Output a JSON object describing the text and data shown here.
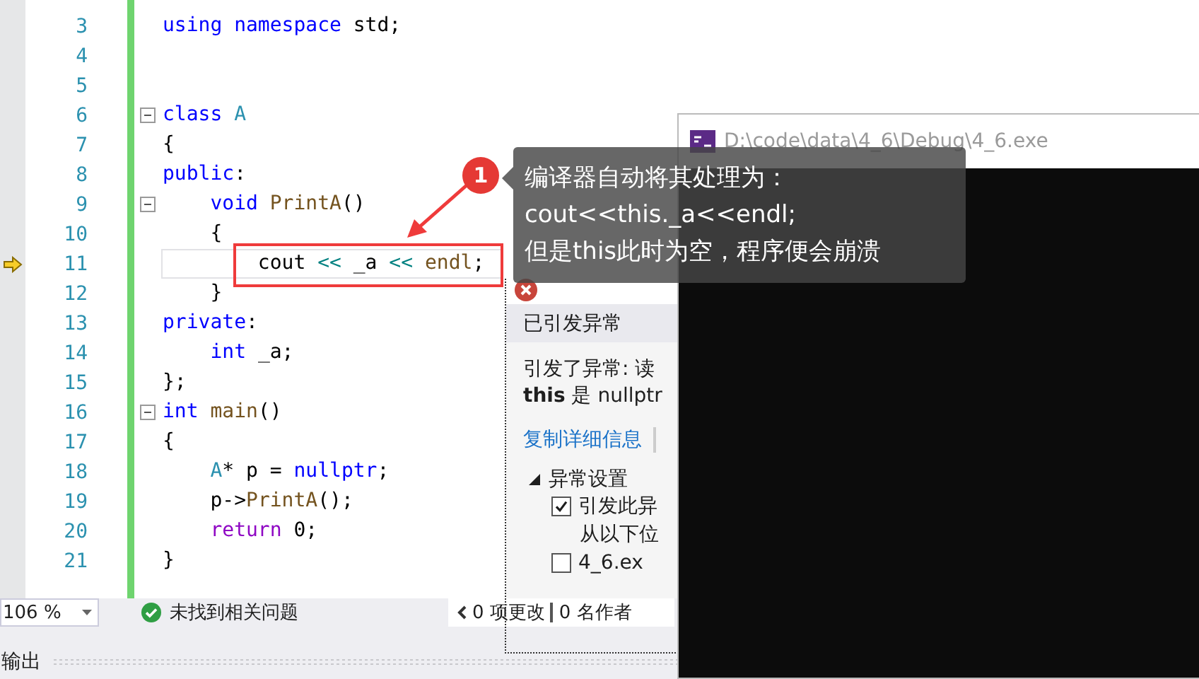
{
  "editor": {
    "lines": [
      {
        "number": "3",
        "fold": false,
        "current": false,
        "tokens": [
          {
            "kind": "keyword",
            "text": "using namespace"
          },
          {
            "kind": "plain",
            "text": " std;"
          }
        ]
      },
      {
        "number": "4",
        "fold": false,
        "current": false
      },
      {
        "number": "5",
        "fold": false,
        "current": false
      },
      {
        "number": "6",
        "fold": true,
        "current": false,
        "tokens": [
          {
            "kind": "keyword",
            "text": "class"
          },
          {
            "kind": "type",
            "text": " A"
          }
        ]
      },
      {
        "number": "7",
        "fold": false,
        "current": false,
        "tokens": [
          {
            "kind": "plain",
            "text": "{"
          }
        ]
      },
      {
        "number": "8",
        "fold": false,
        "current": false,
        "tokens": [
          {
            "kind": "keyword",
            "text": "public"
          },
          {
            "kind": "plain",
            "text": ":"
          }
        ]
      },
      {
        "number": "9",
        "fold": true,
        "current": false,
        "tokens": [
          {
            "kind": "keyword",
            "text": "    void"
          },
          {
            "kind": "function",
            "text": " PrintA"
          },
          {
            "kind": "plain",
            "text": "()"
          }
        ]
      },
      {
        "number": "10",
        "fold": false,
        "current": false,
        "tokens": [
          {
            "kind": "plain",
            "text": "    {"
          }
        ]
      },
      {
        "number": "11",
        "fold": false,
        "current": true,
        "tokens": [
          {
            "kind": "plain",
            "text": "        cout"
          },
          {
            "kind": "operator",
            "text": " <<"
          },
          {
            "kind": "plain",
            "text": " _a"
          },
          {
            "kind": "operator",
            "text": " <<"
          },
          {
            "kind": "function",
            "text": " endl"
          },
          {
            "kind": "plain",
            "text": ";"
          }
        ]
      },
      {
        "number": "12",
        "fold": false,
        "current": false,
        "tokens": [
          {
            "kind": "plain",
            "text": "    }"
          }
        ]
      },
      {
        "number": "13",
        "fold": false,
        "current": false,
        "tokens": [
          {
            "kind": "keyword",
            "text": "private"
          },
          {
            "kind": "plain",
            "text": ":"
          }
        ]
      },
      {
        "number": "14",
        "fold": false,
        "current": false,
        "tokens": [
          {
            "kind": "keyword",
            "text": "    int"
          },
          {
            "kind": "plain",
            "text": " _a;"
          }
        ]
      },
      {
        "number": "15",
        "fold": false,
        "current": false,
        "tokens": [
          {
            "kind": "plain",
            "text": "};"
          }
        ]
      },
      {
        "number": "16",
        "fold": true,
        "current": false,
        "tokens": [
          {
            "kind": "keyword",
            "text": "int"
          },
          {
            "kind": "function",
            "text": " main"
          },
          {
            "kind": "plain",
            "text": "()"
          }
        ]
      },
      {
        "number": "17",
        "fold": false,
        "current": false,
        "tokens": [
          {
            "kind": "plain",
            "text": "{"
          }
        ]
      },
      {
        "number": "18",
        "fold": false,
        "current": false,
        "tokens": [
          {
            "kind": "type",
            "text": "    A"
          },
          {
            "kind": "plain",
            "text": "* p = "
          },
          {
            "kind": "keyword",
            "text": "nullptr"
          },
          {
            "kind": "plain",
            "text": ";"
          }
        ]
      },
      {
        "number": "19",
        "fold": false,
        "current": false,
        "tokens": [
          {
            "kind": "plain",
            "text": "    p->"
          },
          {
            "kind": "function",
            "text": "PrintA"
          },
          {
            "kind": "plain",
            "text": "();"
          }
        ]
      },
      {
        "number": "20",
        "fold": false,
        "current": false,
        "tokens": [
          {
            "kind": "control",
            "text": "    return"
          },
          {
            "kind": "plain",
            "text": " 0;"
          }
        ]
      },
      {
        "number": "21",
        "fold": false,
        "current": false,
        "tokens": [
          {
            "kind": "plain",
            "text": "}"
          }
        ]
      }
    ]
  },
  "status_bar": {
    "zoom": "106 %",
    "issues": "未找到相关问题",
    "changes": "0 项更改",
    "authors": "0 名作者"
  },
  "exception": {
    "title": "已引发异常",
    "message": "引发了异常: 读",
    "detail": "**this** 是 nullptr",
    "copy_link": "复制详细信息",
    "settings": {
      "label": "异常设置",
      "expanded": true,
      "options": [
        {
          "kind": "checkbox",
          "label": "引发此异",
          "checked": true
        },
        {
          "kind": "text",
          "label": "从以下位"
        },
        {
          "kind": "checkbox",
          "label": "4_6.ex",
          "checked": false
        }
      ]
    }
  },
  "console": {
    "title": "D:\\code\\data\\4_6\\Debug\\4_6.exe"
  },
  "annotation": {
    "badge": "1",
    "lines": [
      "编译器自动将其处理为：",
      "cout<<this._a<<endl;",
      "但是this此时为空，程序便会崩溃"
    ]
  },
  "output_panel": {
    "title": "输出"
  }
}
